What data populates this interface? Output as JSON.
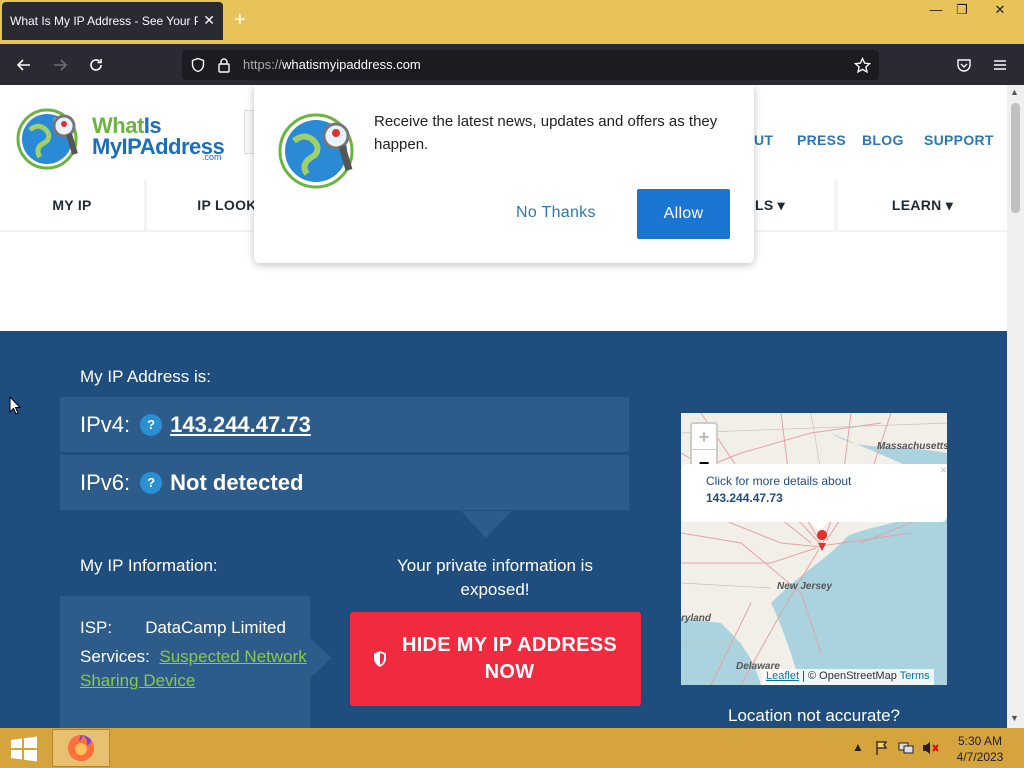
{
  "browser": {
    "tab_title": "What Is My IP Address - See Your Pu",
    "tab_close": "✕",
    "new_tab": "+",
    "url_proto": "https://",
    "url_host": "whatismyipaddress.com",
    "win_min": "—",
    "win_restore": "❐",
    "win_close": "✕"
  },
  "site": {
    "logo_line1_a": "What",
    "logo_line1_b": "Is",
    "logo_line2": "MyIPAddress",
    "logo_com": ".com",
    "toplinks": [
      "UT",
      "PRESS",
      "BLOG",
      "SUPPORT"
    ],
    "nav": [
      "MY IP",
      "IP LOOK",
      "LS ▾",
      "LEARN ▾"
    ]
  },
  "notification": {
    "message": "Receive the latest news, updates and offers as they happen.",
    "no_thanks": "No Thanks",
    "allow": "Allow"
  },
  "hero": {
    "my_ip_label": "My IP Address is:",
    "ipv4_label": "IPv4:",
    "ipv4_value": "143.244.47.73",
    "ipv6_label": "IPv6:",
    "ipv6_value": "Not detected",
    "help": "?",
    "info_label": "My IP Information:",
    "isp_label": "ISP:",
    "isp_value": "DataCamp Limited",
    "services_label": "Services:",
    "services_value": "Suspected Network Sharing Device",
    "exposed": "Your private information is exposed!",
    "hide_button": "HIDE MY IP ADDRESS NOW",
    "location_accurate": "Location not accurate?"
  },
  "map": {
    "zoom_in": "+",
    "zoom_out": "−",
    "popup_line1": "Click for more details about",
    "popup_ip": "143.244.47.73",
    "popup_close": "×",
    "labels": [
      "Massachusetts",
      "New Jersey",
      "ryland",
      "Delaware"
    ],
    "attrib_leaflet": "Leaflet",
    "attrib_sep": " | © OpenStreetMap ",
    "attrib_terms": "Terms"
  },
  "taskbar": {
    "time": "5:30 AM",
    "date": "4/7/2023"
  }
}
